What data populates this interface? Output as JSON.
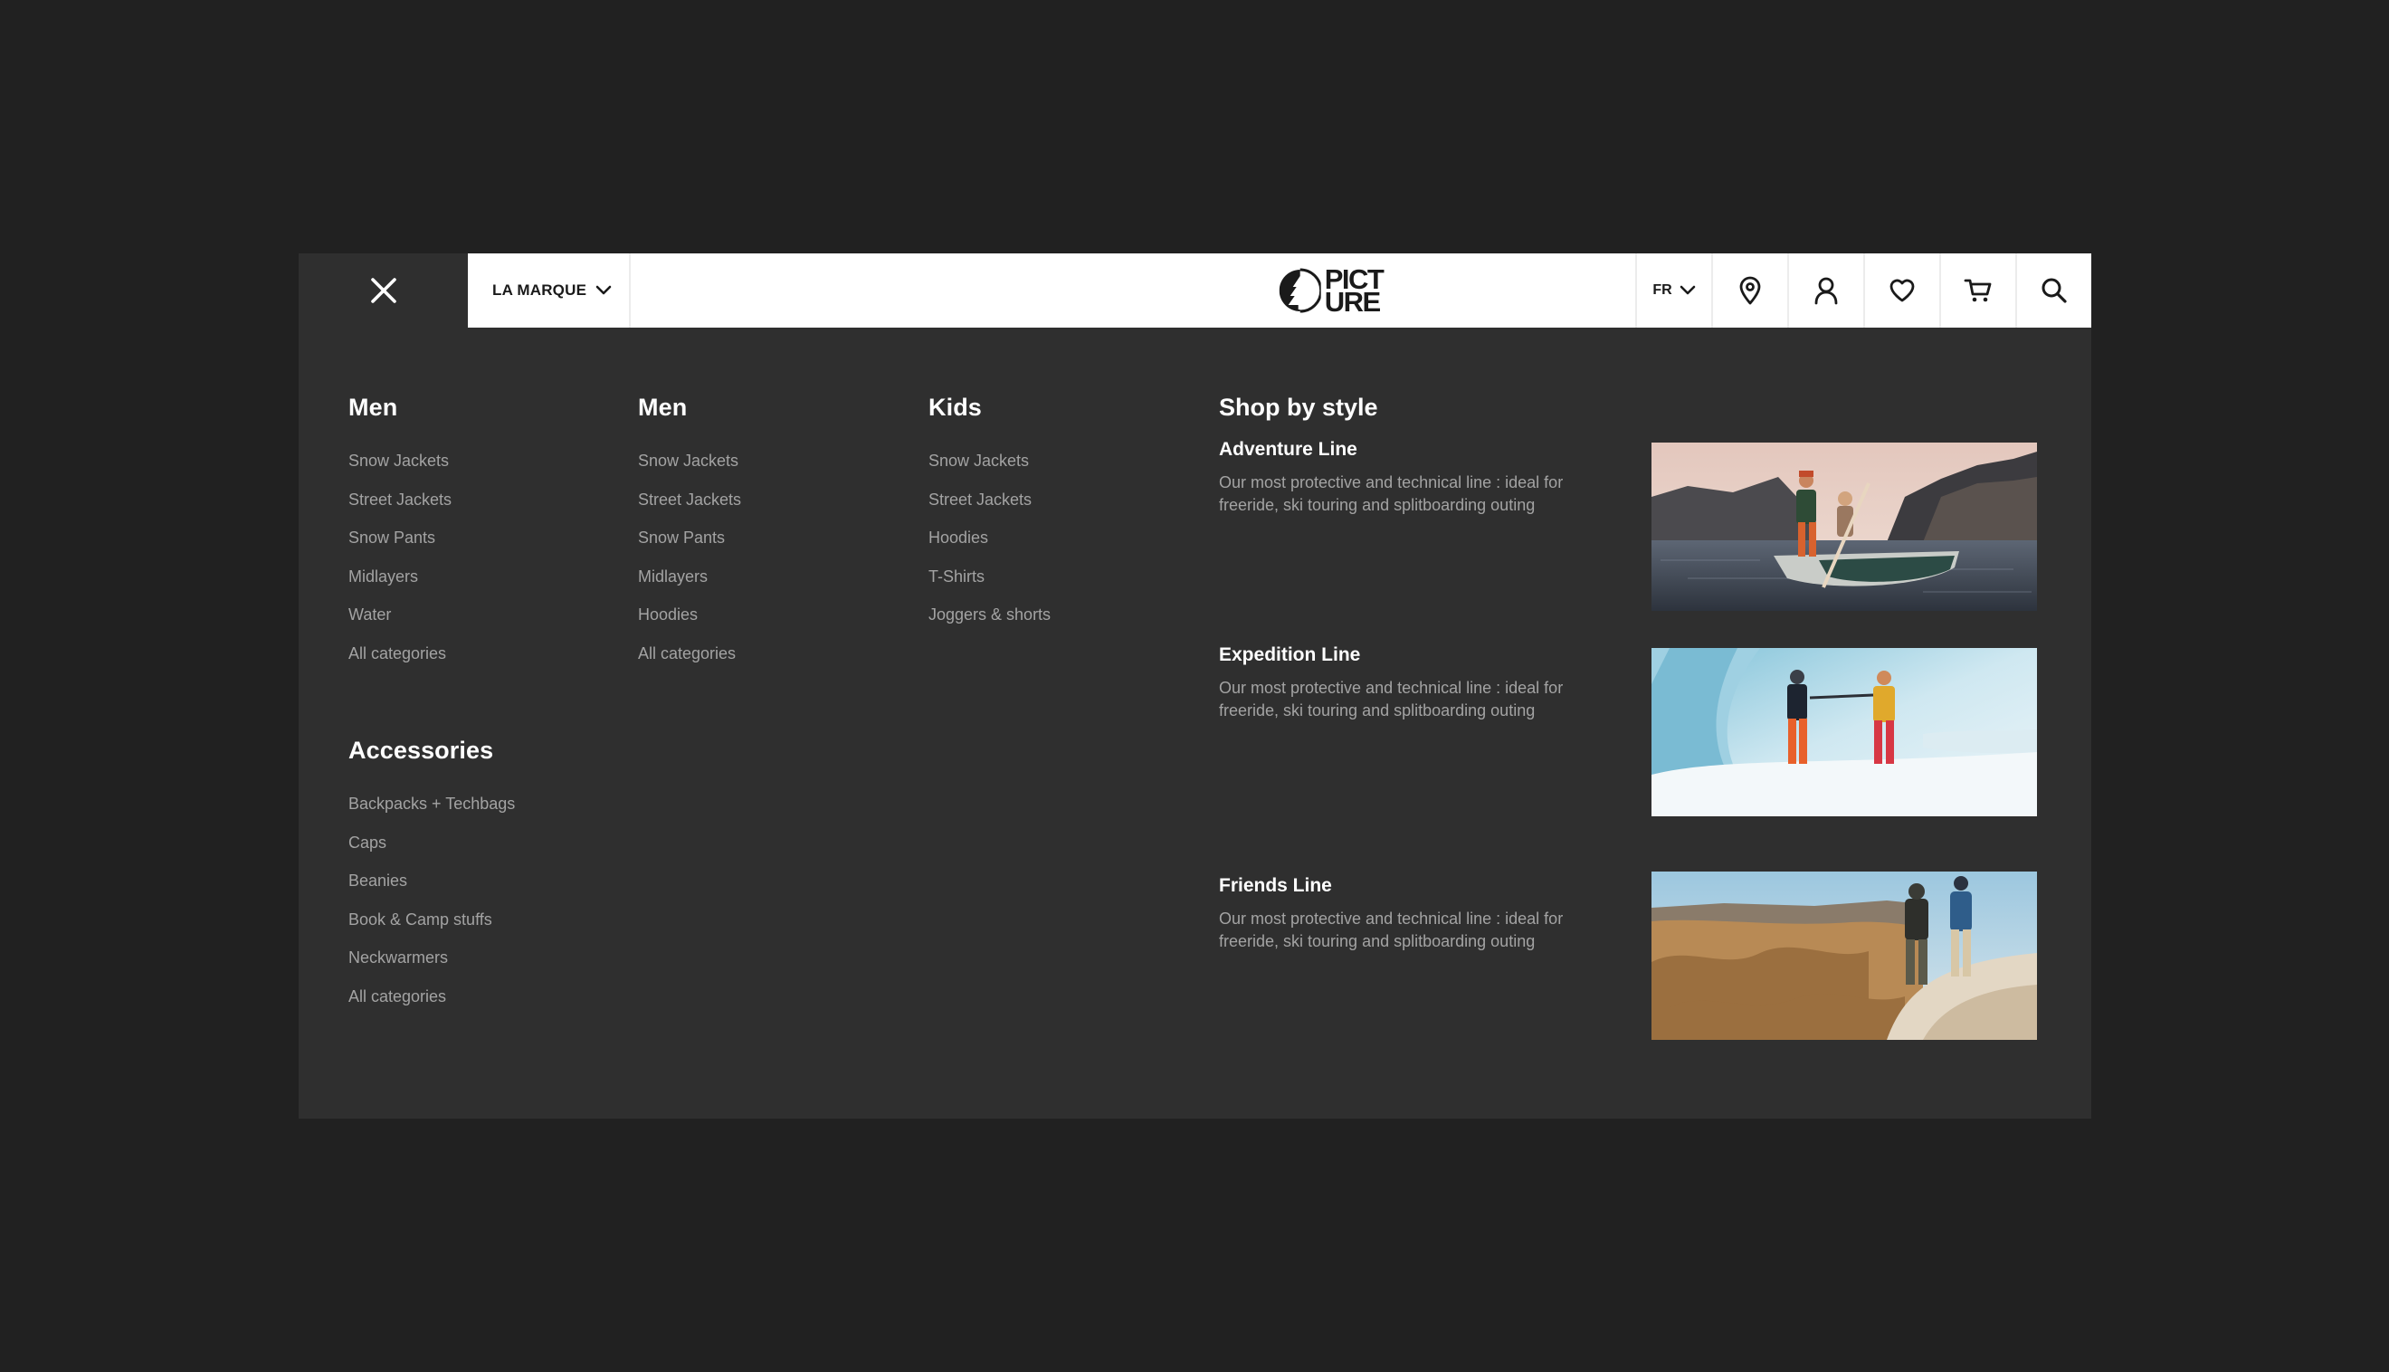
{
  "header": {
    "brand_menu_label": "LA MARQUE",
    "logo_alt": "PICTURE",
    "logo_line1": "PICT",
    "logo_line2": "URE",
    "language": "FR",
    "icons": [
      "close-icon",
      "chevron-down-icon",
      "location-pin-icon",
      "user-icon",
      "heart-icon",
      "cart-icon",
      "search-icon"
    ]
  },
  "columns": [
    {
      "title": "Men",
      "items": [
        "Snow Jackets",
        "Street Jackets",
        "Snow Pants",
        "Midlayers",
        "Water",
        "All categories"
      ]
    },
    {
      "title": "Men",
      "items": [
        "Snow Jackets",
        "Street Jackets",
        "Snow Pants",
        "Midlayers",
        "Hoodies",
        "All categories"
      ]
    },
    {
      "title": "Kids",
      "items": [
        "Snow Jackets",
        "Street Jackets",
        "Hoodies",
        "T-Shirts",
        "Joggers & shorts"
      ]
    }
  ],
  "accessories": {
    "title": "Accessories",
    "items": [
      "Backpacks + Techbags",
      "Caps",
      "Beanies",
      "Book & Camp stuffs",
      "Neckwarmers",
      "All categories"
    ]
  },
  "shop_by_style": {
    "title": "Shop by style",
    "lines": [
      {
        "name": "Adventure Line",
        "description": "Our most protective and technical line : ideal for freeride, ski touring and splitboarding outing",
        "image": "canoe-lake-photo"
      },
      {
        "name": "Expedition Line",
        "description": "Our most protective and technical line : ideal for freeride, ski touring and splitboarding outing",
        "image": "glacier-photo"
      },
      {
        "name": "Friends Line",
        "description": "Our most protective and technical line : ideal for freeride, ski touring and splitboarding outing",
        "image": "badlands-photo"
      }
    ]
  },
  "colors": {
    "page_bg": "#212121",
    "panel_bg": "#2f2f2f",
    "header_bg": "#ffffff",
    "heading_text": "#ffffff",
    "link_text": "#a3a3a3"
  }
}
